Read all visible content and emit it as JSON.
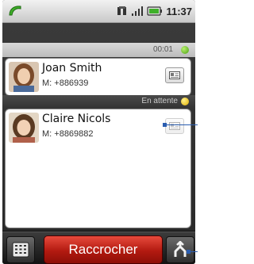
{
  "status_bar": {
    "time": "11:37",
    "icons": [
      "phone-call-icon",
      "network-3g-icon",
      "signal-icon",
      "battery-icon"
    ]
  },
  "active_call": {
    "duration": "00:01",
    "status_color": "#4aa010",
    "contact": {
      "name": "Joan Smith",
      "number": "M: +886939"
    }
  },
  "held_call": {
    "status_text": "En attente",
    "status_color": "#e0b000",
    "contact": {
      "name": "Claire Nicols",
      "number": "M: +8869882"
    }
  },
  "bottom_bar": {
    "end_call_label": "Raccrocher",
    "end_call_color": "#c2281c"
  },
  "callout_color": "#2a5db0"
}
